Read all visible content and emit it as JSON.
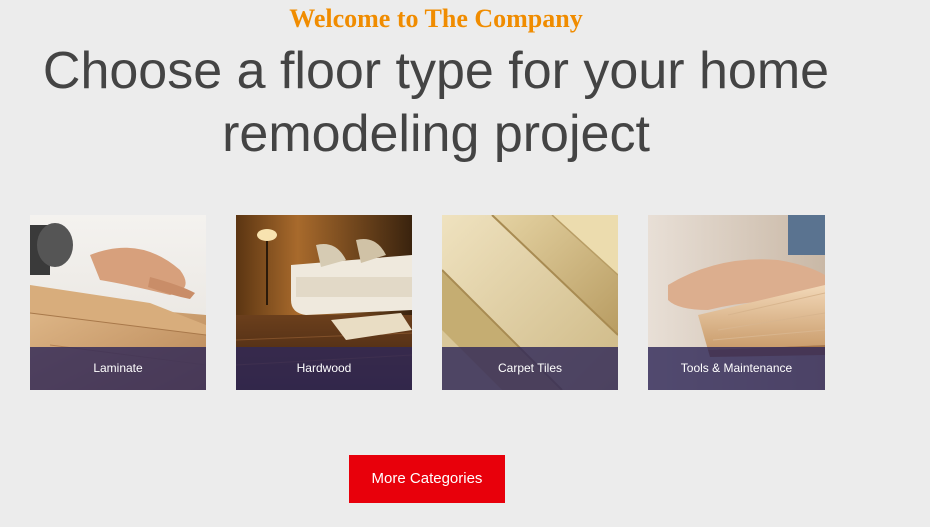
{
  "header": {
    "welcome": "Welcome to The Company",
    "headline": "Choose a floor type for your home remodeling project"
  },
  "categories": [
    {
      "label": "Laminate",
      "image": "laminate-installation-photo"
    },
    {
      "label": "Hardwood",
      "image": "hardwood-living-room-photo"
    },
    {
      "label": "Carpet Tiles",
      "image": "carpet-rolls-photo"
    },
    {
      "label": "Tools & Maintenance",
      "image": "wood-plank-tools-photo"
    }
  ],
  "cta": {
    "label": "More Categories"
  },
  "colors": {
    "accent": "#f08c00",
    "button": "#e8000b",
    "caption_bg": "#302858",
    "heading": "#444444",
    "background": "#ececec"
  }
}
